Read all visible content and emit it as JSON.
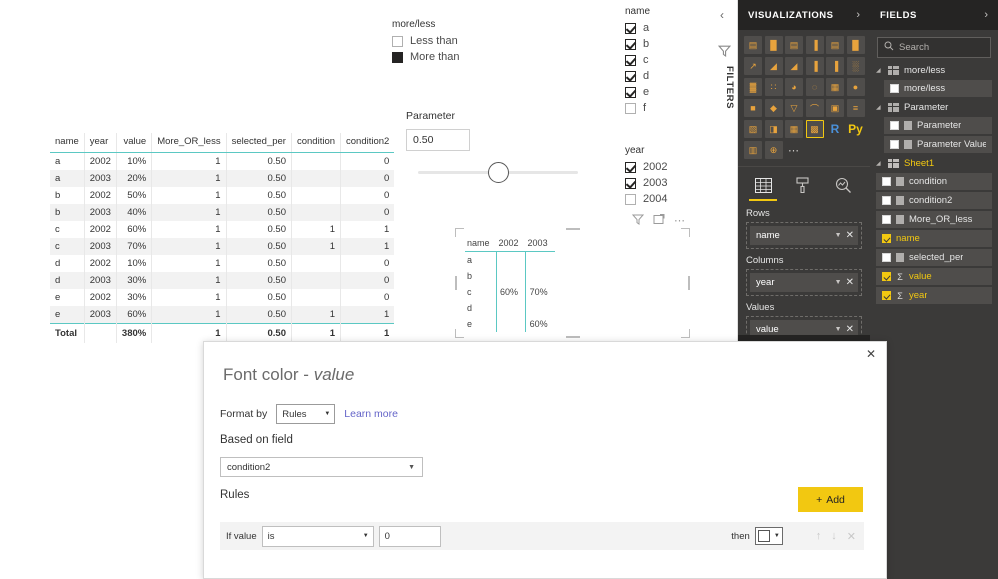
{
  "table_visual": {
    "columns": [
      {
        "label": "name",
        "align": "txt"
      },
      {
        "label": "year",
        "align": "txt"
      },
      {
        "label": "value",
        "align": "num"
      },
      {
        "label": "More_OR_less",
        "align": "num"
      },
      {
        "label": "selected_per",
        "align": "num"
      },
      {
        "label": "condition",
        "align": "num"
      },
      {
        "label": "condition2",
        "align": "num"
      }
    ],
    "rows": [
      [
        "a",
        "2002",
        "10%",
        "1",
        "0.50",
        "",
        "0"
      ],
      [
        "a",
        "2003",
        "20%",
        "1",
        "0.50",
        "",
        "0"
      ],
      [
        "b",
        "2002",
        "50%",
        "1",
        "0.50",
        "",
        "0"
      ],
      [
        "b",
        "2003",
        "40%",
        "1",
        "0.50",
        "",
        "0"
      ],
      [
        "c",
        "2002",
        "60%",
        "1",
        "0.50",
        "1",
        "1"
      ],
      [
        "c",
        "2003",
        "70%",
        "1",
        "0.50",
        "1",
        "1"
      ],
      [
        "d",
        "2002",
        "10%",
        "1",
        "0.50",
        "",
        "0"
      ],
      [
        "d",
        "2003",
        "30%",
        "1",
        "0.50",
        "",
        "0"
      ],
      [
        "e",
        "2002",
        "30%",
        "1",
        "0.50",
        "",
        "0"
      ],
      [
        "e",
        "2003",
        "60%",
        "1",
        "0.50",
        "1",
        "1"
      ]
    ],
    "total_row": [
      "Total",
      "",
      "380%",
      "1",
      "0.50",
      "1",
      "1"
    ]
  },
  "slicer_moreless": {
    "title": "more/less",
    "items": [
      {
        "label": "Less than",
        "state": "unchecked"
      },
      {
        "label": "More than",
        "state": "filled"
      }
    ]
  },
  "parameter": {
    "label": "Parameter",
    "value": "0.50",
    "slider_percent": 50
  },
  "slicer_name": {
    "title": "name",
    "items": [
      {
        "label": "a",
        "state": "checked"
      },
      {
        "label": "b",
        "state": "checked"
      },
      {
        "label": "c",
        "state": "checked"
      },
      {
        "label": "d",
        "state": "checked"
      },
      {
        "label": "e",
        "state": "checked"
      },
      {
        "label": "f",
        "state": "unchecked"
      }
    ]
  },
  "slicer_year": {
    "title": "year",
    "items": [
      {
        "label": "2002",
        "state": "checked"
      },
      {
        "label": "2003",
        "state": "checked"
      },
      {
        "label": "2004",
        "state": "unchecked"
      }
    ]
  },
  "matrix_visual": {
    "header_icons": [
      "filter-icon",
      "focus-mode-icon",
      "more-options-icon"
    ],
    "columns": [
      "name",
      "2002",
      "2003"
    ],
    "rows": [
      {
        "name": "a",
        "2002": "",
        "2003": ""
      },
      {
        "name": "b",
        "2002": "",
        "2003": ""
      },
      {
        "name": "c",
        "2002": "60%",
        "2003": "70%"
      },
      {
        "name": "d",
        "2002": "",
        "2003": ""
      },
      {
        "name": "e",
        "2002": "",
        "2003": "60%"
      }
    ]
  },
  "filters_rail": {
    "collapse_chevron": "‹",
    "label": "FILTERS"
  },
  "visualizations_pane": {
    "title": "VISUALIZATIONS",
    "chevron": "›",
    "icons": [
      {
        "name": "stacked-bar-chart-icon",
        "glyph": "▤",
        "selected": false
      },
      {
        "name": "stacked-column-chart-icon",
        "glyph": "█",
        "selected": false
      },
      {
        "name": "clustered-bar-chart-icon",
        "glyph": "▤",
        "selected": false
      },
      {
        "name": "clustered-column-chart-icon",
        "glyph": "▐",
        "selected": false
      },
      {
        "name": "100-percent-stacked-bar-chart-icon",
        "glyph": "▤",
        "selected": false
      },
      {
        "name": "100-percent-stacked-column-chart-icon",
        "glyph": "█",
        "selected": false
      },
      {
        "name": "line-chart-icon",
        "glyph": "↗",
        "selected": false
      },
      {
        "name": "area-chart-icon",
        "glyph": "◢",
        "selected": false
      },
      {
        "name": "stacked-area-chart-icon",
        "glyph": "◢",
        "selected": false
      },
      {
        "name": "line-and-stacked-column-chart-icon",
        "glyph": "▐",
        "selected": false
      },
      {
        "name": "line-and-clustered-column-chart-icon",
        "glyph": "▐",
        "selected": false
      },
      {
        "name": "ribbon-chart-icon",
        "glyph": "░",
        "selected": false
      },
      {
        "name": "waterfall-chart-icon",
        "glyph": "▓",
        "selected": false
      },
      {
        "name": "scatter-chart-icon",
        "glyph": "∷",
        "selected": false
      },
      {
        "name": "pie-chart-icon",
        "glyph": "◕",
        "selected": false
      },
      {
        "name": "donut-chart-icon",
        "glyph": "◌",
        "selected": false
      },
      {
        "name": "treemap-icon",
        "glyph": "▦",
        "selected": false
      },
      {
        "name": "map-icon",
        "glyph": "●",
        "selected": false
      },
      {
        "name": "filled-map-icon",
        "glyph": "■",
        "selected": false
      },
      {
        "name": "shape-map-icon",
        "glyph": "◆",
        "selected": false
      },
      {
        "name": "funnel-chart-icon",
        "glyph": "▽",
        "selected": false
      },
      {
        "name": "gauge-chart-icon",
        "glyph": "⌒",
        "selected": false
      },
      {
        "name": "card-icon",
        "glyph": "▣",
        "selected": false
      },
      {
        "name": "multi-row-card-icon",
        "glyph": "≡",
        "selected": false
      },
      {
        "name": "kpi-icon",
        "glyph": "▧",
        "selected": false
      },
      {
        "name": "slicer-icon",
        "glyph": "◨",
        "selected": false
      },
      {
        "name": "table-icon",
        "glyph": "▦",
        "selected": false
      },
      {
        "name": "matrix-icon",
        "glyph": "▩",
        "selected": true
      },
      {
        "name": "r-script-visual-icon",
        "glyph": "R",
        "selected": false,
        "style": "text-blue"
      },
      {
        "name": "python-visual-icon",
        "glyph": "Py",
        "selected": false,
        "style": "text-yellow"
      },
      {
        "name": "key-influencers-icon",
        "glyph": "▥",
        "selected": false
      },
      {
        "name": "arcgis-maps-icon",
        "glyph": "⊕",
        "selected": false
      },
      {
        "name": "get-more-visuals-icon",
        "glyph": "⋯",
        "selected": false,
        "style": "dots"
      }
    ],
    "tabs": [
      {
        "name": "fields-tab",
        "glyph": "▦",
        "active": true
      },
      {
        "name": "format-tab",
        "glyph": "⎙",
        "active": false
      },
      {
        "name": "analytics-tab",
        "glyph": "⚲",
        "active": false
      }
    ],
    "wells": [
      {
        "label": "Rows",
        "field": "name"
      },
      {
        "label": "Columns",
        "field": "year"
      },
      {
        "label": "Values",
        "field": "value"
      }
    ],
    "filters_title": "FILTERS"
  },
  "fields_pane": {
    "title": "FIELDS",
    "chevron": "›",
    "search_placeholder": "Search",
    "groups": [
      {
        "name": "more/less",
        "active": false,
        "items": [
          {
            "label": "more/less",
            "checked": false,
            "kind": "field",
            "indent": true
          }
        ]
      },
      {
        "name": "Parameter",
        "active": false,
        "items": [
          {
            "label": "Parameter",
            "checked": false,
            "kind": "column",
            "indent": true
          },
          {
            "label": "Parameter Value",
            "checked": false,
            "kind": "column",
            "indent": true
          }
        ]
      },
      {
        "name": "Sheet1",
        "active": true,
        "items": [
          {
            "label": "condition",
            "checked": false,
            "kind": "column",
            "indent": false
          },
          {
            "label": "condition2",
            "checked": false,
            "kind": "column",
            "indent": false
          },
          {
            "label": "More_OR_less",
            "checked": false,
            "kind": "column",
            "indent": false
          },
          {
            "label": "name",
            "checked": true,
            "kind": "plain",
            "indent": false
          },
          {
            "label": "selected_per",
            "checked": false,
            "kind": "column",
            "indent": false
          },
          {
            "label": "value",
            "checked": true,
            "kind": "sigma",
            "indent": false
          },
          {
            "label": "year",
            "checked": true,
            "kind": "sigma",
            "indent": false
          }
        ]
      }
    ]
  },
  "dialog": {
    "title_prefix": "Font color - ",
    "title_field": "value",
    "close_label": "✕",
    "format_by_label": "Format by",
    "format_by_value": "Rules",
    "learn_more": "Learn more",
    "based_on_field_label": "Based on field",
    "based_on_field_value": "condition2",
    "rules_label": "Rules",
    "add_button": "Add",
    "add_button_plus": "+",
    "rule": {
      "if_label": "If value",
      "operator": "is",
      "value": "0",
      "then_label": "then"
    }
  },
  "colors": {
    "accent_yellow": "#f2c811",
    "teal_rule": "#5bc8c3",
    "pane_dark": "#3b3a39",
    "pane_header": "#252423",
    "link_purple": "#6464c8"
  }
}
